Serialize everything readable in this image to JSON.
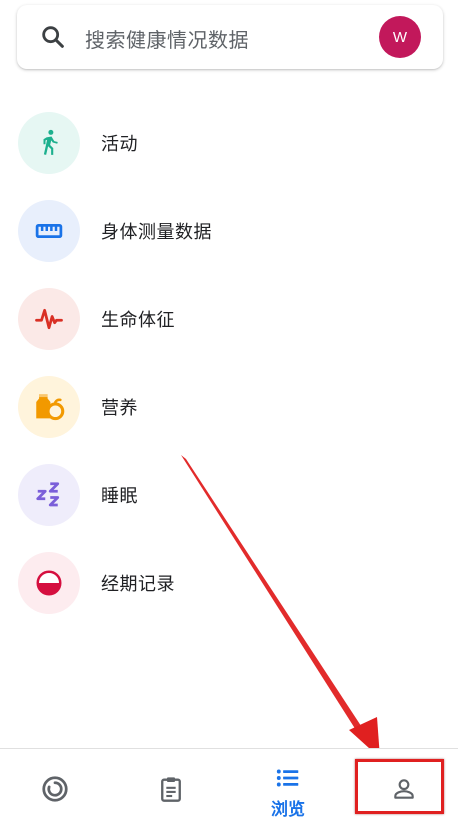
{
  "search": {
    "placeholder": "搜索健康情况数据",
    "avatar_initial": "W",
    "avatar_color": "#c2185b"
  },
  "categories": [
    {
      "label": "活动",
      "icon": "walking-person-icon",
      "bg": "#e6f7f3",
      "color": "#1db08e"
    },
    {
      "label": "身体测量数据",
      "icon": "ruler-icon",
      "bg": "#e8effc",
      "color": "#1a73e8"
    },
    {
      "label": "生命体征",
      "icon": "heartbeat-icon",
      "bg": "#fbe9e7",
      "color": "#d93025"
    },
    {
      "label": "营养",
      "icon": "nutrition-icon",
      "bg": "#fff4dc",
      "color": "#f29900"
    },
    {
      "label": "睡眠",
      "icon": "sleep-zzz-icon",
      "bg": "#efedfb",
      "color": "#7b5fd9"
    },
    {
      "label": "经期记录",
      "icon": "cycle-tracking-icon",
      "bg": "#fdecef",
      "color": "#d50f3f"
    }
  ],
  "bottom_nav": {
    "items": [
      {
        "name": "today",
        "icon": "circle-progress-icon"
      },
      {
        "name": "journal",
        "icon": "clipboard-icon"
      },
      {
        "name": "browse",
        "icon": "list-icon",
        "label": "浏览",
        "active": true
      },
      {
        "name": "profile",
        "icon": "person-icon"
      }
    ],
    "active_color": "#1a73e8",
    "inactive_color": "#5f6368"
  },
  "annotation": {
    "color": "#e02020"
  }
}
